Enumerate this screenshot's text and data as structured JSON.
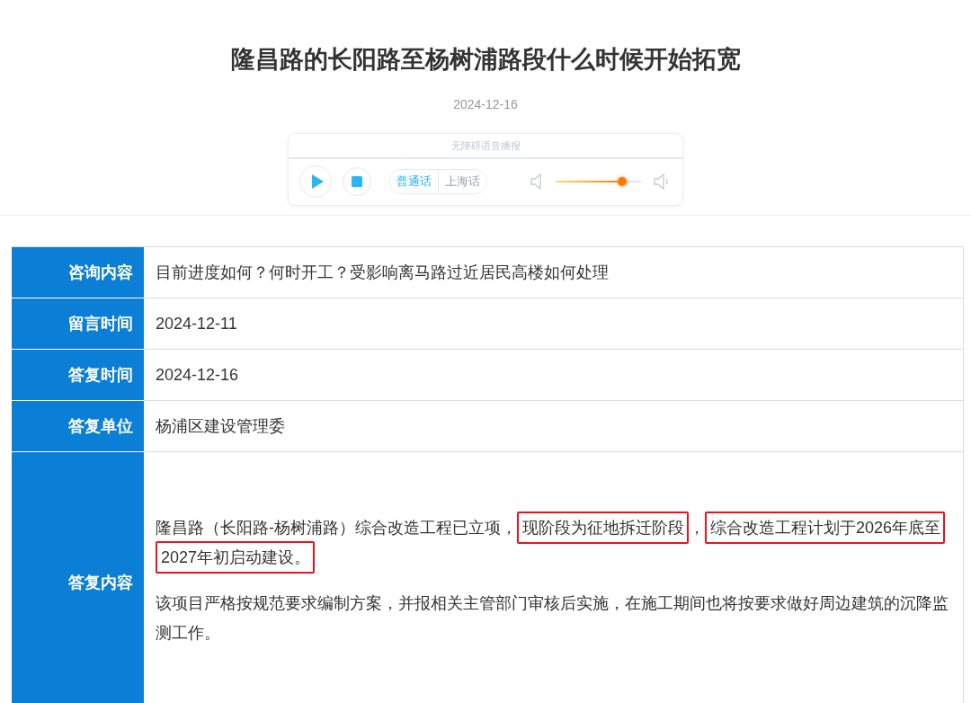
{
  "title": "隆昌路的长阳路至杨树浦路段什么时候开始拓宽",
  "date": "2024-12-16",
  "player": {
    "caption": "无障碍语音播报",
    "playing": false,
    "languages": [
      {
        "label": "普通话",
        "selected": true
      },
      {
        "label": "上海话",
        "selected": false
      }
    ],
    "volume": {
      "level": 0.78
    }
  },
  "rows": [
    {
      "label": "咨询内容",
      "value": "目前进度如何？何时开工？受影响离马路过近居民高楼如何处理"
    },
    {
      "label": "留言时间",
      "value": "2024-12-11"
    },
    {
      "label": "答复时间",
      "value": "2024-12-16"
    },
    {
      "label": "答复单位",
      "value": "杨浦区建设管理委"
    }
  ],
  "answer": {
    "label": "答复内容",
    "paragraphs": [
      [
        {
          "text": "隆昌路（长阳路-杨树浦路）综合改造工程已立项，",
          "highlighted": false
        },
        {
          "text": "现阶段为征地拆迁阶段",
          "highlighted": true
        },
        {
          "text": "，",
          "highlighted": false
        },
        {
          "text": "综合改造工程计划于2026年底至2027年初启动建设。",
          "highlighted": true
        }
      ],
      [
        {
          "text": "该项目严格按规范要求编制方案，并报相关主管部门审核后实施，在施工期间也将按要求做好周边建筑的沉降监测工作。",
          "highlighted": false
        }
      ]
    ]
  }
}
